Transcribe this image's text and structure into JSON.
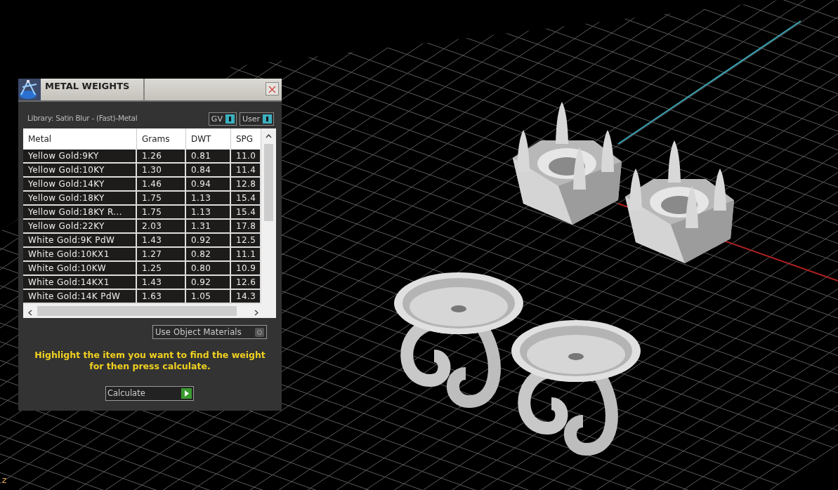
{
  "viewport": {
    "axis_label": "z"
  },
  "panel": {
    "title": "METAL WEIGHTS",
    "library": "Library: Satin Blur - (Fast)-Metal",
    "toggles": [
      {
        "label": "GV",
        "on": true
      },
      {
        "label": "User",
        "on": true
      }
    ],
    "table": {
      "columns": [
        "Metal",
        "Grams",
        "DWT",
        "SPG"
      ],
      "rows": [
        [
          "Yellow Gold:9KY",
          "1.26",
          "0.81",
          "11.0"
        ],
        [
          "Yellow Gold:10KY",
          "1.30",
          "0.84",
          "11.4"
        ],
        [
          "Yellow Gold:14KY",
          "1.46",
          "0.94",
          "12.8"
        ],
        [
          "Yellow Gold:18KY",
          "1.75",
          "1.13",
          "15.4"
        ],
        [
          "Yellow Gold:18KY R...",
          "1.75",
          "1.13",
          "15.4"
        ],
        [
          "Yellow Gold:22KY",
          "2.03",
          "1.31",
          "17.8"
        ],
        [
          "White Gold:9K PdW",
          "1.43",
          "0.92",
          "12.5"
        ],
        [
          "White Gold:10KX1",
          "1.27",
          "0.82",
          "11.1"
        ],
        [
          "White Gold:10KW",
          "1.25",
          "0.80",
          "10.9"
        ],
        [
          "White Gold:14KX1",
          "1.43",
          "0.92",
          "12.6"
        ],
        [
          "White Gold:14K PdW",
          "1.63",
          "1.05",
          "14.3"
        ]
      ]
    },
    "object_materials": {
      "label": "Use Object Materials",
      "on": false
    },
    "hint": "Highlight the item you want to find the weight for then press calculate.",
    "calculate": {
      "label": "Calculate"
    }
  }
}
